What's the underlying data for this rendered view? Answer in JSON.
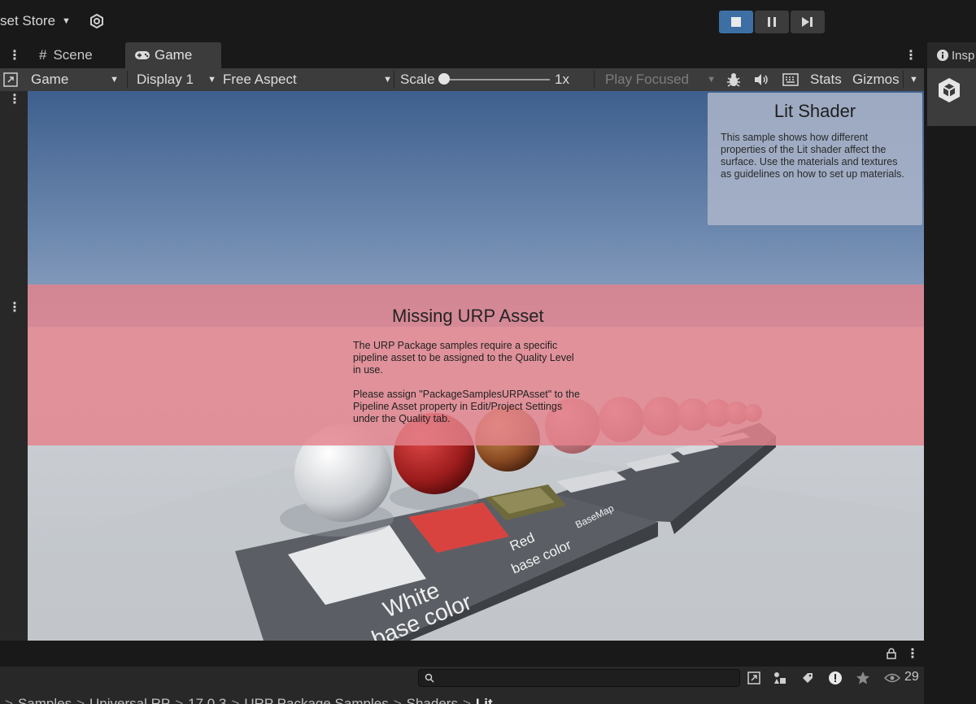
{
  "topbar": {
    "asset_store_label": "set Store",
    "play_controls": [
      "play",
      "pause",
      "step"
    ]
  },
  "game_panel": {
    "tabs": [
      {
        "label": "Scene",
        "icon": "grid-icon"
      },
      {
        "label": "Game",
        "icon": "gamepad-icon"
      }
    ],
    "toolbar": {
      "game_dropdown": "Game",
      "display_dropdown": "Display 1",
      "aspect_dropdown": "Free Aspect",
      "scale_label": "Scale",
      "scale_value": "1x",
      "play_mode_dropdown": "Play Focused",
      "stats_label": "Stats",
      "gizmos_label": "Gizmos"
    }
  },
  "viewport": {
    "lit_info": {
      "title": "Lit Shader",
      "body": "This sample shows how different properties of the Lit shader affect the surface. Use the materials and textures as guidelines on how to set up materials."
    },
    "missing_urp": {
      "title": "Missing URP Asset",
      "line1": "The URP Package samples require a specific",
      "line2": "pipeline asset to be assigned to the Quality Level",
      "line3": "in use.",
      "line4": "Please assign \"PackageSamplesURPAsset\" to the",
      "line5": "Pipeline Asset property in Edit/Project Settings",
      "line6": "under the Quality tab."
    },
    "plaque_labels": {
      "white": "White",
      "white_sub": "base color",
      "red": "Red",
      "red_sub": "base color",
      "basemap": "BaseMap"
    }
  },
  "inspector": {
    "tab_label": "Insp"
  },
  "project": {
    "search_placeholder": "",
    "visible_count": "29",
    "breadcrumb": [
      "Samples",
      "Universal RP",
      "17.0.3",
      "URP Package Samples",
      "Shaders",
      "Lit"
    ]
  },
  "colors": {
    "accent": "#3d6fa5",
    "panel_dark": "#191919",
    "panel_mid": "#282828",
    "toolbar": "#3c3c3c"
  }
}
